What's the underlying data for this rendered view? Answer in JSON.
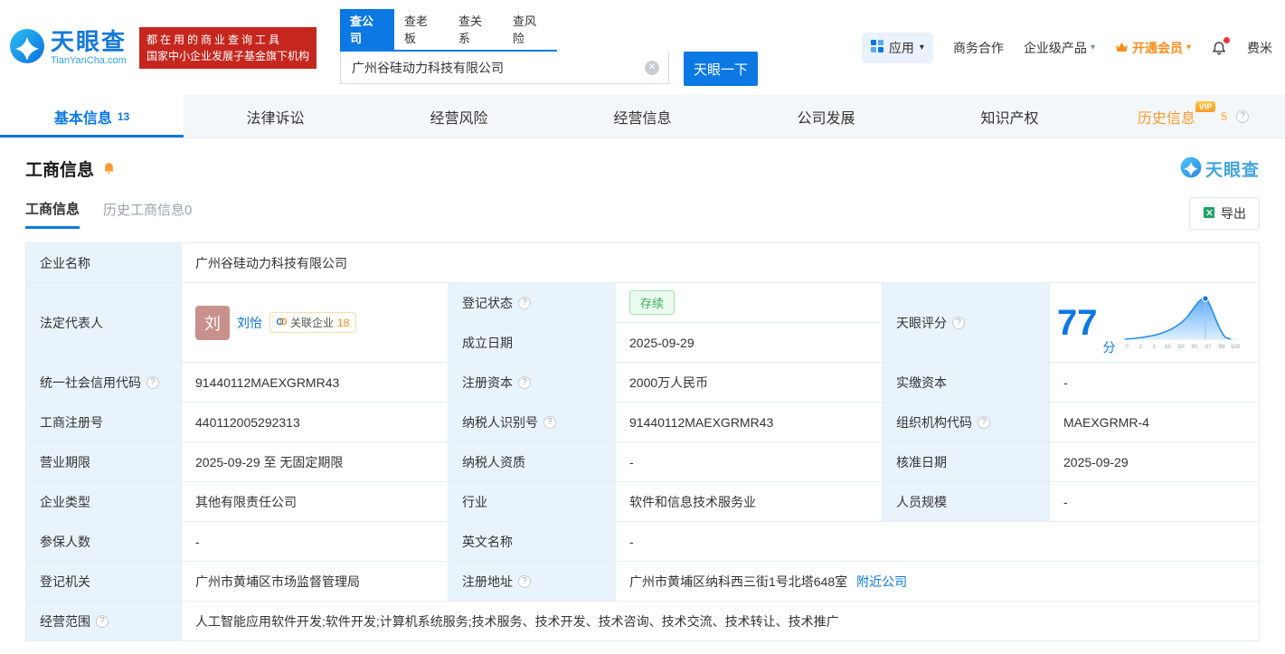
{
  "icons": {
    "help": "?",
    "caret": "▾",
    "clear": "✕"
  },
  "header": {
    "logo_brand": "天眼查",
    "logo_domain": "TianYanCha.com",
    "slogan_line1": "都在用的商业查询工具",
    "slogan_line2": "国家中小企业发展子基金旗下机构",
    "search_tabs": [
      {
        "label": "查公司"
      },
      {
        "label": "查老板"
      },
      {
        "label": "查关系"
      },
      {
        "label": "查风险"
      }
    ],
    "search_value": "广州谷硅动力科技有限公司",
    "search_button": "天眼一下",
    "nav_app": "应用",
    "nav_cooperation": "商务合作",
    "nav_enterprise": "企业级产品",
    "nav_vip": "开通会员",
    "nav_user": "费米"
  },
  "tabs": [
    {
      "label": "基本信息",
      "count": "13"
    },
    {
      "label": "法律诉讼",
      "count": ""
    },
    {
      "label": "经营风险",
      "count": ""
    },
    {
      "label": "经营信息",
      "count": ""
    },
    {
      "label": "公司发展",
      "count": ""
    },
    {
      "label": "知识产权",
      "count": ""
    },
    {
      "label": "历史信息",
      "count": "5",
      "vip": "VIP"
    }
  ],
  "section": {
    "title": "工商信息",
    "watermark": "天眼查",
    "subtab_active": "工商信息",
    "subtab_history": "历史工商信息",
    "subtab_history_count": "0",
    "export_label": "导出"
  },
  "info": {
    "company_name_label": "企业名称",
    "company_name": "广州谷硅动力科技有限公司",
    "legal_rep_label": "法定代表人",
    "legal_rep_avatar": "刘",
    "legal_rep_name": "刘怡",
    "related_label": "关联企业",
    "related_count": "18",
    "reg_status_label": "登记状态",
    "reg_status": "存续",
    "establish_date_label": "成立日期",
    "establish_date": "2025-09-29",
    "score_label": "天眼评分",
    "score_value": "77",
    "score_unit": "分",
    "credit_code_label": "统一社会信用代码",
    "credit_code": "91440112MAEXGRMR43",
    "reg_capital_label": "注册资本",
    "reg_capital": "2000万人民币",
    "paid_capital_label": "实缴资本",
    "paid_capital": "-",
    "reg_number_label": "工商注册号",
    "reg_number": "440112005292313",
    "taxpayer_id_label": "纳税人识别号",
    "taxpayer_id": "91440112MAEXGRMR43",
    "org_code_label": "组织机构代码",
    "org_code": "MAEXGRMR-4",
    "business_term_label": "营业期限",
    "business_term": "2025-09-29 至 无固定期限",
    "taxpayer_quality_label": "纳税人资质",
    "taxpayer_quality": "-",
    "approval_date_label": "核准日期",
    "approval_date": "2025-09-29",
    "company_type_label": "企业类型",
    "company_type": "其他有限责任公司",
    "industry_label": "行业",
    "industry": "软件和信息技术服务业",
    "staff_size_label": "人员规模",
    "staff_size": "-",
    "insured_label": "参保人数",
    "insured": "-",
    "english_name_label": "英文名称",
    "english_name": "-",
    "reg_authority_label": "登记机关",
    "reg_authority": "广州市黄埔区市场监督管理局",
    "reg_address_label": "注册地址",
    "reg_address": "广州市黄埔区纳科西三街1号北塔648室",
    "nearby_link": "附近公司",
    "business_scope_label": "经营范围",
    "business_scope": "人工智能应用软件开发;软件开发;计算机系统服务;技术服务、技术开发、技术咨询、技术交流、技术转让、技术推广"
  },
  "score_chart": {
    "type": "area",
    "x_ticks": [
      "0",
      "1",
      "3",
      "15",
      "50",
      "85",
      "97",
      "99",
      "100"
    ],
    "accent_color": "#0b78e3"
  }
}
